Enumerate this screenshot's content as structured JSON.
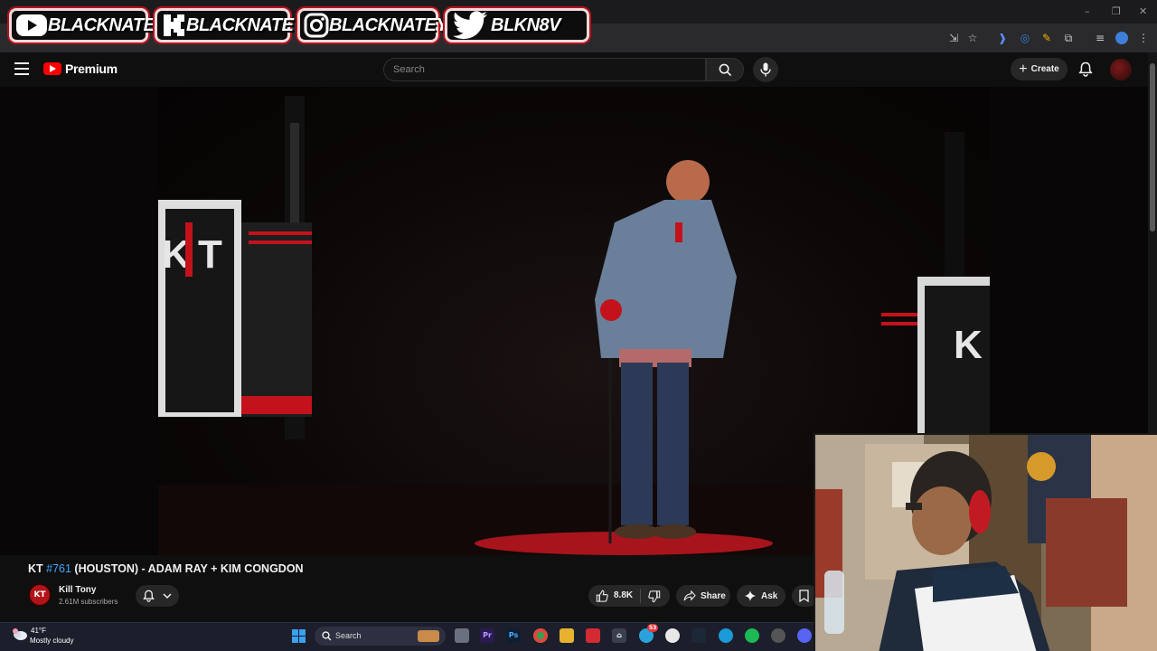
{
  "overlay": {
    "banners": [
      {
        "platform": "youtube-icon",
        "text": "BLACKNATE"
      },
      {
        "platform": "kick-icon",
        "text": "BLACKNATE"
      },
      {
        "platform": "instagram-icon",
        "text": "BLACKNATEYT"
      },
      {
        "platform": "twitter-icon",
        "text": "BLKN8V"
      }
    ]
  },
  "youtube": {
    "logo_text": "Premium",
    "search_placeholder": "Search",
    "create_label": "Create",
    "video": {
      "title_prefix": "KT ",
      "title_tag": "#761",
      "title_rest": " (HOUSTON) - ADAM RAY + KIM CONGDON",
      "channel_name": "Kill Tony",
      "channel_avatar_text": "KT",
      "subscribers": "2.61M subscribers",
      "likes": "8.8K",
      "share_label": "Share",
      "ask_label": "Ask",
      "stage_logo": "KT"
    }
  },
  "taskbar": {
    "weather_temp": "41°F",
    "weather_desc": "Mostly cloudy",
    "search_label": "Search",
    "badge_count": "53",
    "apps": [
      "file-explorer-icon",
      "premiere-icon",
      "photoshop-icon",
      "chrome-icon",
      "folder-icon",
      "streamlabs-icon",
      "obs-icon",
      "telegram-icon",
      "app-icon",
      "edge-icon",
      "steam-icon",
      "spotify-icon",
      "settings-icon",
      "discord-icon"
    ]
  },
  "colors": {
    "youtube_red": "#ff0000",
    "link_blue": "#3ea6ff",
    "kill_tony_red": "#c4121c",
    "banner_border": "#b3121d"
  }
}
